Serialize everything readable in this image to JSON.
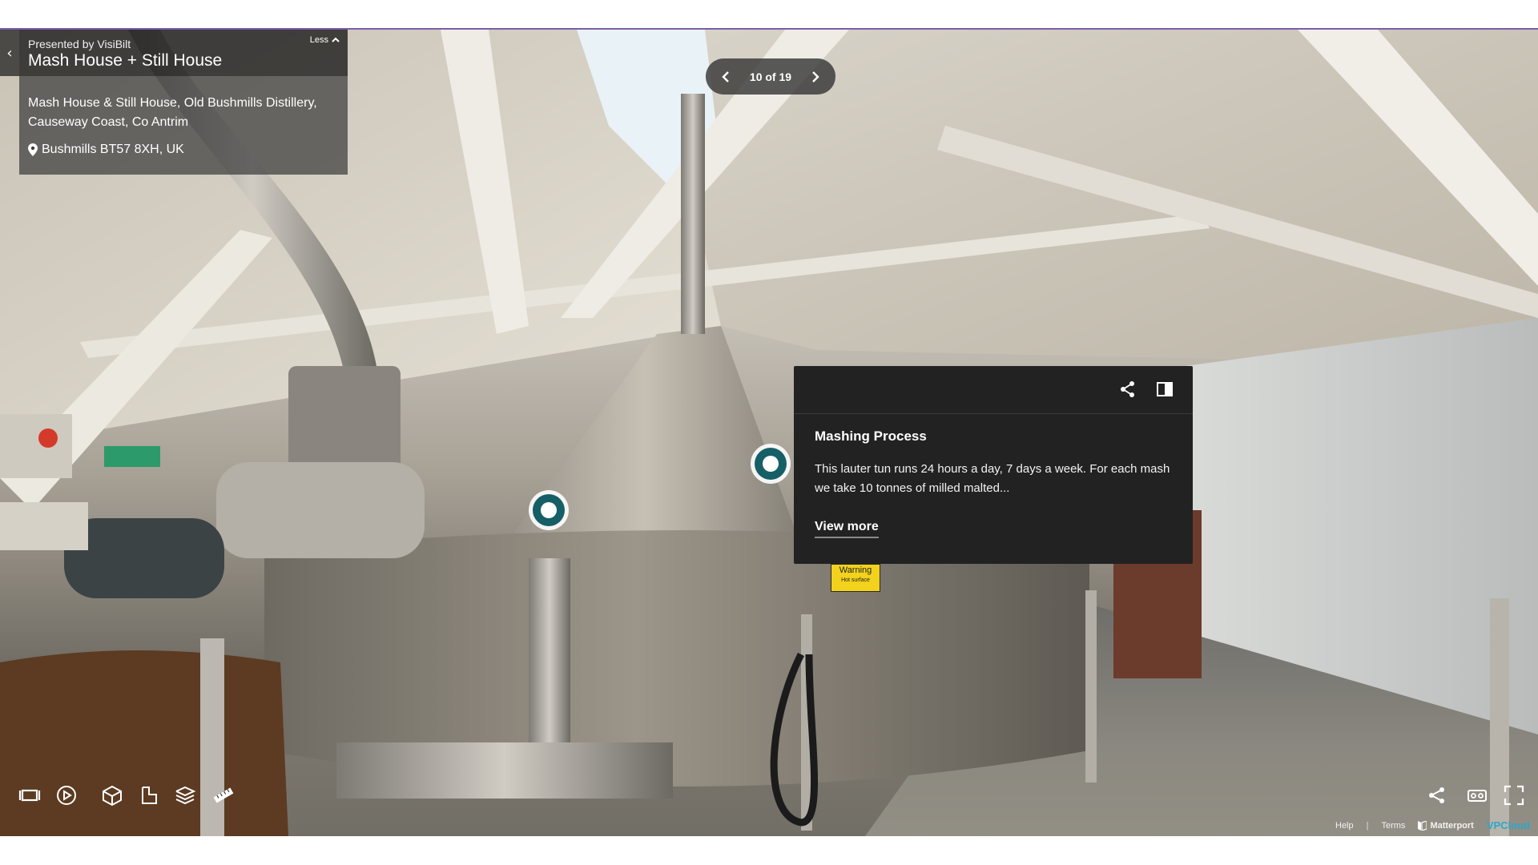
{
  "info_panel": {
    "presented_by": "Presented by VisiBilt",
    "title": "Mash House + Still House",
    "less_label": "Less",
    "description": "Mash House & Still House, Old Bushmills Distillery, Causeway Coast, Co Antrim",
    "location": "Bushmills BT57 8XH, UK"
  },
  "highlight_nav": {
    "count": "10 of 19"
  },
  "tag_popup": {
    "title": "Mashing Process",
    "text": "This lauter tun runs 24 hours a day, 7 days a week. For each mash we take 10 tonnes of milled malted...",
    "view_more": "View more"
  },
  "scene": {
    "warning_sign_title": "Warning",
    "warning_sign_sub": "Hot surface"
  },
  "footer": {
    "help": "Help",
    "terms": "Terms",
    "brand": "Matterport",
    "provider": "VPCloud"
  },
  "colors": {
    "tag_teal": "#165f66",
    "panel_dark": "#222222",
    "accent_rule": "#7b5ea7"
  }
}
